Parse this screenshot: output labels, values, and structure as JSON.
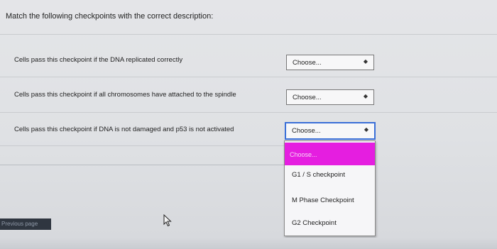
{
  "instruction": "Match the following checkpoints with the correct description:",
  "rows": [
    {
      "label": "Cells pass this checkpoint if the DNA replicated correctly",
      "select": "Choose..."
    },
    {
      "label": "Cells pass this checkpoint if all chromosomes have attached to the spindle",
      "select": "Choose..."
    },
    {
      "label": "Cells pass this checkpoint if DNA is not damaged and p53 is not activated",
      "select": "Choose..."
    }
  ],
  "select_arrow_icon": "up-down-arrows-icon",
  "dropdown": {
    "highlighted": "Choose...",
    "options": [
      "G1 / S checkpoint",
      "M Phase Checkpoint",
      "G2 Checkpoint"
    ],
    "highlight_color": "#e51ee0"
  },
  "previous_page": "Previous page",
  "cursor_icon": "mouse-pointer-icon"
}
